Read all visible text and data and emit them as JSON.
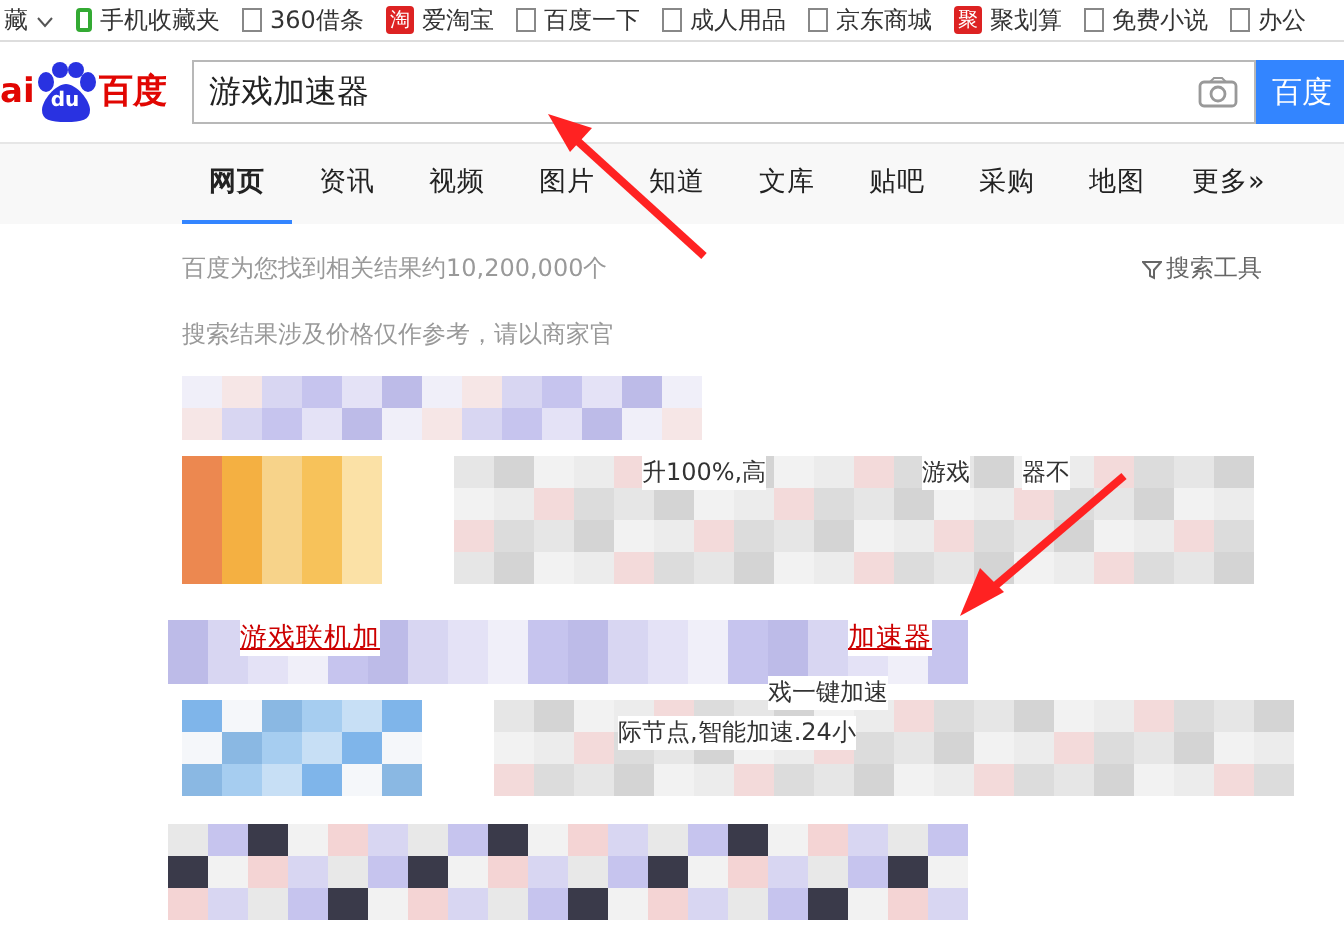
{
  "bookmarks": [
    {
      "label": "藏",
      "kind": "menu"
    },
    {
      "label": "手机收藏夹",
      "kind": "phone"
    },
    {
      "label": "360借条",
      "kind": "page"
    },
    {
      "label": "爱淘宝",
      "kind": "brand",
      "badge": "淘"
    },
    {
      "label": "百度一下",
      "kind": "page"
    },
    {
      "label": "成人用品",
      "kind": "page"
    },
    {
      "label": "京东商城",
      "kind": "page"
    },
    {
      "label": "聚划算",
      "kind": "brand",
      "badge": "聚"
    },
    {
      "label": "免费小说",
      "kind": "page"
    },
    {
      "label": "办公",
      "kind": "page"
    }
  ],
  "logo": {
    "left": "ai",
    "paw": "du",
    "right": "百度"
  },
  "search": {
    "value": "游戏加速器",
    "button": "百度"
  },
  "tabs": [
    {
      "label": "网页",
      "selected": true
    },
    {
      "label": "资讯",
      "selected": false
    },
    {
      "label": "视频",
      "selected": false
    },
    {
      "label": "图片",
      "selected": false
    },
    {
      "label": "知道",
      "selected": false
    },
    {
      "label": "文库",
      "selected": false
    },
    {
      "label": "贴吧",
      "selected": false
    },
    {
      "label": "采购",
      "selected": false
    },
    {
      "label": "地图",
      "selected": false
    },
    {
      "label": "更多»",
      "selected": false
    }
  ],
  "result_count": "百度为您找到相关结果约10,200,000个",
  "search_tools": "搜索工具",
  "notice": "搜索结果涉及价格仅作参考，请以商家官",
  "results": [
    {
      "fragments": [
        "升100%,高",
        "游戏",
        "器不"
      ]
    },
    {
      "title_parts": [
        "游戏联机加",
        "加速器"
      ],
      "fragments": [
        "戏一键加速",
        "际节点,智能加速.24小"
      ]
    }
  ]
}
